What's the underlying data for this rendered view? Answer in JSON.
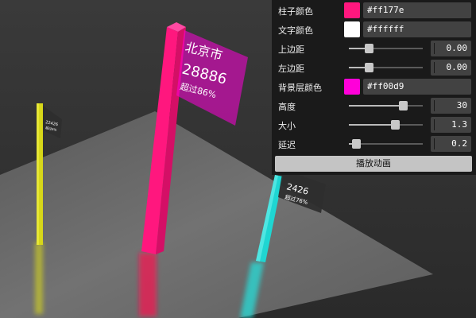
{
  "colors": {
    "bar": "#ff177e",
    "text": "#ffffff",
    "label_bg": "#ff00d9",
    "cyan_bar": "#1fd6d2",
    "yellow_bar": "#d7d719",
    "floor": "#6a6a6a"
  },
  "bars": {
    "main": {
      "city": "北京市",
      "value": "28886",
      "note": "超过86%"
    },
    "cyan": {
      "value": "2426",
      "note": "超过76%"
    },
    "yellow": {
      "value": "22426",
      "note": "超过6%"
    }
  },
  "controls": {
    "bar_color": {
      "label": "柱子颜色",
      "value": "#ff177e"
    },
    "text_color": {
      "label": "文字颜色",
      "value": "#ffffff"
    },
    "top_margin": {
      "label": "上边距",
      "value": "0.00",
      "level": 0.27
    },
    "left_margin": {
      "label": "左边距",
      "value": "0.00",
      "level": 0.27
    },
    "bg_color": {
      "label": "背景层颜色",
      "value": "#ff00d9"
    },
    "height": {
      "label": "高度",
      "value": "30",
      "level": 0.73
    },
    "size": {
      "label": "大小",
      "value": "1.3",
      "level": 0.62
    },
    "delay": {
      "label": "延迟",
      "value": "0.2",
      "level": 0.1
    },
    "play_label": "播放动画"
  }
}
